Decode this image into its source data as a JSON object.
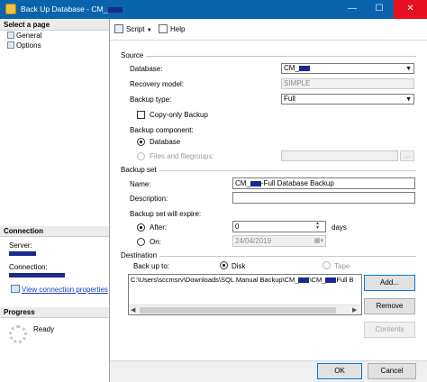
{
  "window": {
    "title_prefix": "Back Up Database - CM_",
    "minimize_glyph": "—",
    "maximize_glyph": "☐",
    "close_glyph": "✕"
  },
  "left_panel": {
    "select_page_header": "Select a page",
    "pages": [
      {
        "label": "General",
        "icon": "page-icon"
      },
      {
        "label": "Options",
        "icon": "page-icon"
      }
    ],
    "connection_header": "Connection",
    "server_label": "Server:",
    "connection_label": "Connection:",
    "view_connection_properties": "View connection properties",
    "progress_header": "Progress",
    "progress_status": "Ready"
  },
  "toolbar": {
    "script_label": "Script",
    "script_dropdown_glyph": "▼",
    "help_label": "Help"
  },
  "source": {
    "group_label": "Source",
    "database_label": "Database:",
    "database_value": "CM_",
    "recovery_model_label": "Recovery model:",
    "recovery_model_value": "SIMPLE",
    "backup_type_label": "Backup type:",
    "backup_type_value": "Full",
    "copy_only_label": "Copy-only Backup",
    "copy_only_checked": false,
    "backup_component_label": "Backup component:",
    "component_database_label": "Database",
    "component_files_label": "Files and filegroups:",
    "component_selected": "Database",
    "files_browse_label": "..."
  },
  "backup_set": {
    "group_label": "Backup set",
    "name_label": "Name:",
    "name_prefix": "CM_",
    "name_suffix": "-Full Database Backup",
    "description_label": "Description:",
    "description_value": "",
    "expire_label": "Backup set will expire:",
    "after_label": "After:",
    "after_value": "0",
    "days_label": "days",
    "on_label": "On:",
    "on_value": "24/04/2019",
    "expire_selected": "After"
  },
  "destination": {
    "group_label": "Destination",
    "backup_to_label": "Back up to:",
    "disk_label": "Disk",
    "tape_label": "Tape",
    "selected": "Disk",
    "path_part1": "C:\\Users\\sccmsrv\\Downloads\\SQL Manual Backup\\CM_",
    "path_part2": "\\CM_",
    "path_part3": "Full B",
    "add_label": "Add...",
    "remove_label": "Remove",
    "contents_label": "Contents"
  },
  "footer": {
    "ok_label": "OK",
    "cancel_label": "Cancel"
  }
}
